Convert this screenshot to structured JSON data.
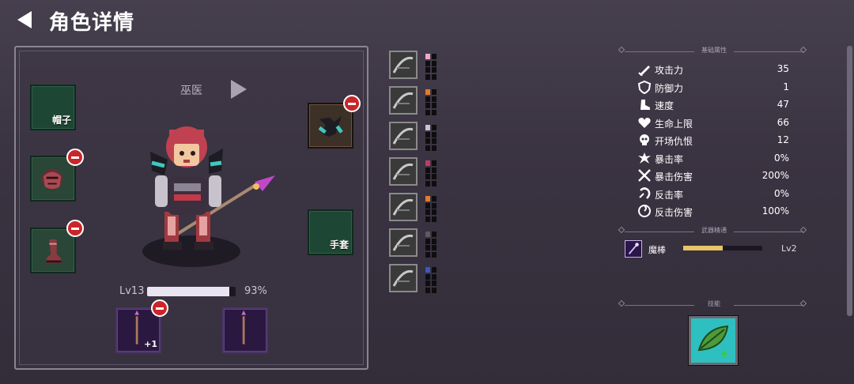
{
  "header": {
    "title": "角色详情",
    "back_icon": "back-arrow-icon"
  },
  "character": {
    "class_name": "巫医",
    "level_label": "Lv13",
    "xp_percent_label": "93%",
    "xp_fraction": 0.93
  },
  "equipment": {
    "hat_label": "帽子",
    "gloves_label": "手套",
    "weapon_plus_label": "+1"
  },
  "skill_list": [
    {
      "icon": "boot-skill-icon",
      "color": "#f3a6c6"
    },
    {
      "icon": "forest-skill-icon",
      "color": "#e37b2a"
    },
    {
      "icon": "leaf-skill-icon",
      "color": "#c9c3d6"
    },
    {
      "icon": "sword-skill-icon",
      "color": "#c23a6a"
    },
    {
      "icon": "web-skill-icon",
      "color": "#e37b2a"
    },
    {
      "icon": "shadow-skill-icon",
      "color": "#5a5a60"
    },
    {
      "icon": "branch-skill-icon",
      "color": "#3a56c8"
    }
  ],
  "stats": {
    "section_title": "基础属性",
    "rows": [
      {
        "icon": "sword-icon",
        "name": "攻击力",
        "value": "35"
      },
      {
        "icon": "shield-icon",
        "name": "防御力",
        "value": "1"
      },
      {
        "icon": "boot-icon",
        "name": "速度",
        "value": "47"
      },
      {
        "icon": "heart-icon",
        "name": "生命上限",
        "value": "66"
      },
      {
        "icon": "skull-icon",
        "name": "开场仇恨",
        "value": "12"
      },
      {
        "icon": "crit-burst-icon",
        "name": "暴击率",
        "value": "0%"
      },
      {
        "icon": "crossed-swords-icon",
        "name": "暴击伤害",
        "value": "200%"
      },
      {
        "icon": "counter-icon",
        "name": "反击率",
        "value": "0%"
      },
      {
        "icon": "swirl-icon",
        "name": "反击伤害",
        "value": "100%"
      }
    ]
  },
  "mastery": {
    "section_title": "武器精通",
    "weapon_name": "魔棒",
    "level": "Lv2",
    "fraction": 0.5
  },
  "skills": {
    "section_title": "技能",
    "icon": "green-leaf-skill-icon"
  },
  "colors": {
    "slot_green": "#1e4634",
    "badge_red": "#c8262b",
    "mastery_gold": "#e8c46a"
  }
}
